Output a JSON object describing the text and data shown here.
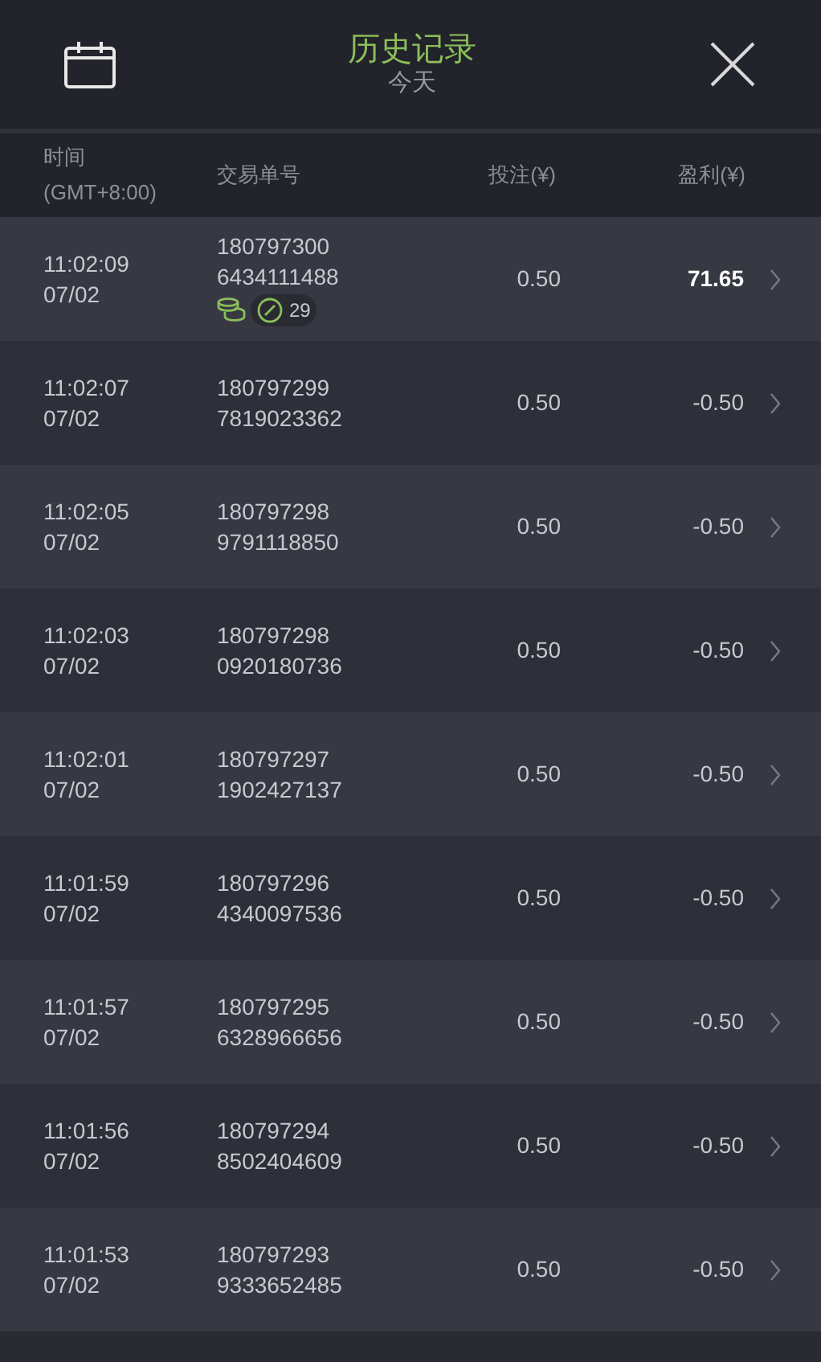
{
  "header": {
    "title": "历史记录",
    "subtitle": "今天"
  },
  "columns": {
    "time": "时间",
    "timezone": "(GMT+8:00)",
    "order": "交易单号",
    "stake": "投注(¥)",
    "profit": "盈利(¥)"
  },
  "rows": [
    {
      "time": "11:02:09",
      "date": "07/02",
      "order_1": "180797300",
      "order_2": "6434111488",
      "stake": "0.50",
      "profit": "71.65",
      "won": true,
      "badge_count": "29"
    },
    {
      "time": "11:02:07",
      "date": "07/02",
      "order_1": "180797299",
      "order_2": "7819023362",
      "stake": "0.50",
      "profit": "-0.50",
      "won": false
    },
    {
      "time": "11:02:05",
      "date": "07/02",
      "order_1": "180797298",
      "order_2": "9791118850",
      "stake": "0.50",
      "profit": "-0.50",
      "won": false
    },
    {
      "time": "11:02:03",
      "date": "07/02",
      "order_1": "180797298",
      "order_2": "0920180736",
      "stake": "0.50",
      "profit": "-0.50",
      "won": false
    },
    {
      "time": "11:02:01",
      "date": "07/02",
      "order_1": "180797297",
      "order_2": "1902427137",
      "stake": "0.50",
      "profit": "-0.50",
      "won": false
    },
    {
      "time": "11:01:59",
      "date": "07/02",
      "order_1": "180797296",
      "order_2": "4340097536",
      "stake": "0.50",
      "profit": "-0.50",
      "won": false
    },
    {
      "time": "11:01:57",
      "date": "07/02",
      "order_1": "180797295",
      "order_2": "6328966656",
      "stake": "0.50",
      "profit": "-0.50",
      "won": false
    },
    {
      "time": "11:01:56",
      "date": "07/02",
      "order_1": "180797294",
      "order_2": "8502404609",
      "stake": "0.50",
      "profit": "-0.50",
      "won": false
    },
    {
      "time": "11:01:53",
      "date": "07/02",
      "order_1": "180797293",
      "order_2": "9333652485",
      "stake": "0.50",
      "profit": "-0.50",
      "won": false
    }
  ]
}
